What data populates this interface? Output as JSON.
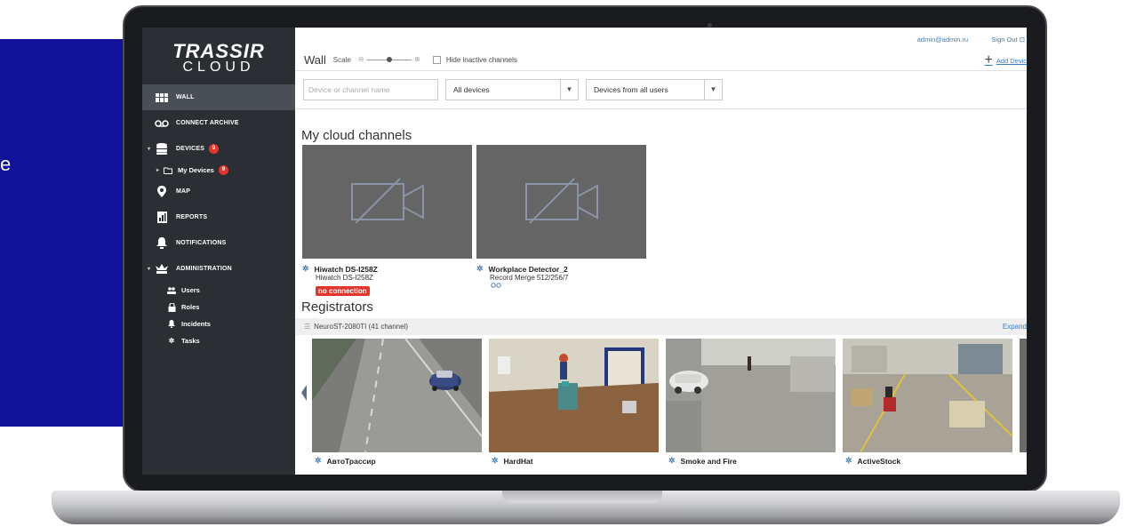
{
  "edge_text": "e",
  "sidebar": {
    "logo_main": "TRASSIR",
    "logo_sub": "CLOUD",
    "items": [
      {
        "label": "WALL",
        "icon": "wall-grid-icon"
      },
      {
        "label": "CONNECT ARCHIVE",
        "icon": "archive-icon"
      },
      {
        "label": "DEVICES",
        "icon": "database-icon",
        "badge": "9"
      },
      {
        "label": "MAP",
        "icon": "map-pin-icon"
      },
      {
        "label": "REPORTS",
        "icon": "reports-icon"
      },
      {
        "label": "NOTIFICATIONS",
        "icon": "bell-icon"
      },
      {
        "label": "ADMINISTRATION",
        "icon": "admin-icon"
      }
    ],
    "my_devices": {
      "label": "My Devices",
      "badge": "9"
    },
    "admin_sub": [
      {
        "label": "Users",
        "icon": "users-icon"
      },
      {
        "label": "Roles",
        "icon": "lock-icon"
      },
      {
        "label": "Incidents",
        "icon": "bell-icon"
      },
      {
        "label": "Tasks",
        "icon": "gear-icon"
      }
    ]
  },
  "topbar": {
    "email": "admin@admin.ru",
    "signout": "Sign Out"
  },
  "wallbar": {
    "title": "Wall",
    "scale_label": "Scale",
    "hide_label": "Hide inactive channels",
    "add_device": "Add Devic"
  },
  "filters": {
    "search_placeholder": "Device or channel name",
    "devices_select": "All devices",
    "users_select": "Devices from all users"
  },
  "cloud_channels": {
    "title": "My cloud channels",
    "cards": [
      {
        "name": "Hiwatch DS-I258Z",
        "sub": "Hiwatch DS-I258Z",
        "status": "no connection"
      },
      {
        "name": "Workplace Detector_2",
        "sub": "Record Merge 512/256/7",
        "status": ""
      }
    ]
  },
  "registrators": {
    "title": "Registrators",
    "group": "NeuroST-2080TI (41 channel)",
    "expand": "Expand",
    "cards": [
      {
        "name": "АвтоТрассир"
      },
      {
        "name": "HardHat"
      },
      {
        "name": "Smoke and Fire"
      },
      {
        "name": "ActiveStock"
      }
    ]
  }
}
